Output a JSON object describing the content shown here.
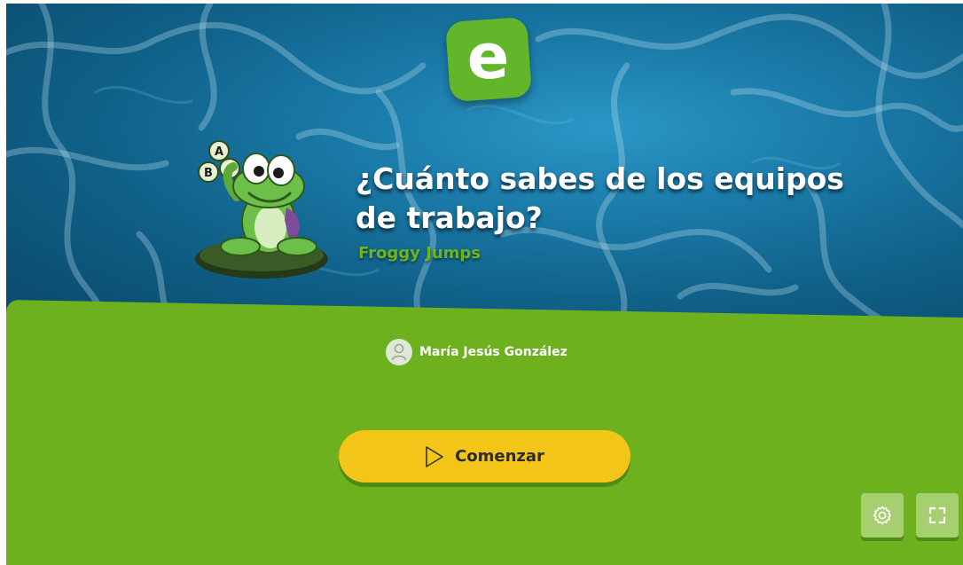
{
  "app": {
    "logo_letter": "e"
  },
  "game": {
    "title": "¿Cuánto sabes de los equipos de trabajo?",
    "subtitle": "Froggy Jumps",
    "letters": [
      "A",
      "B",
      "C"
    ]
  },
  "author": {
    "name": "María Jesús González",
    "icon": "user-icon"
  },
  "actions": {
    "start_label": "Comenzar",
    "start_icon": "play-icon",
    "settings_icon": "gear-icon",
    "fullscreen_icon": "fullscreen-icon"
  },
  "colors": {
    "green": "#6eb11e",
    "yellow": "#f2c518",
    "water": "#1a7aa8",
    "button": "#a6cf6f"
  }
}
